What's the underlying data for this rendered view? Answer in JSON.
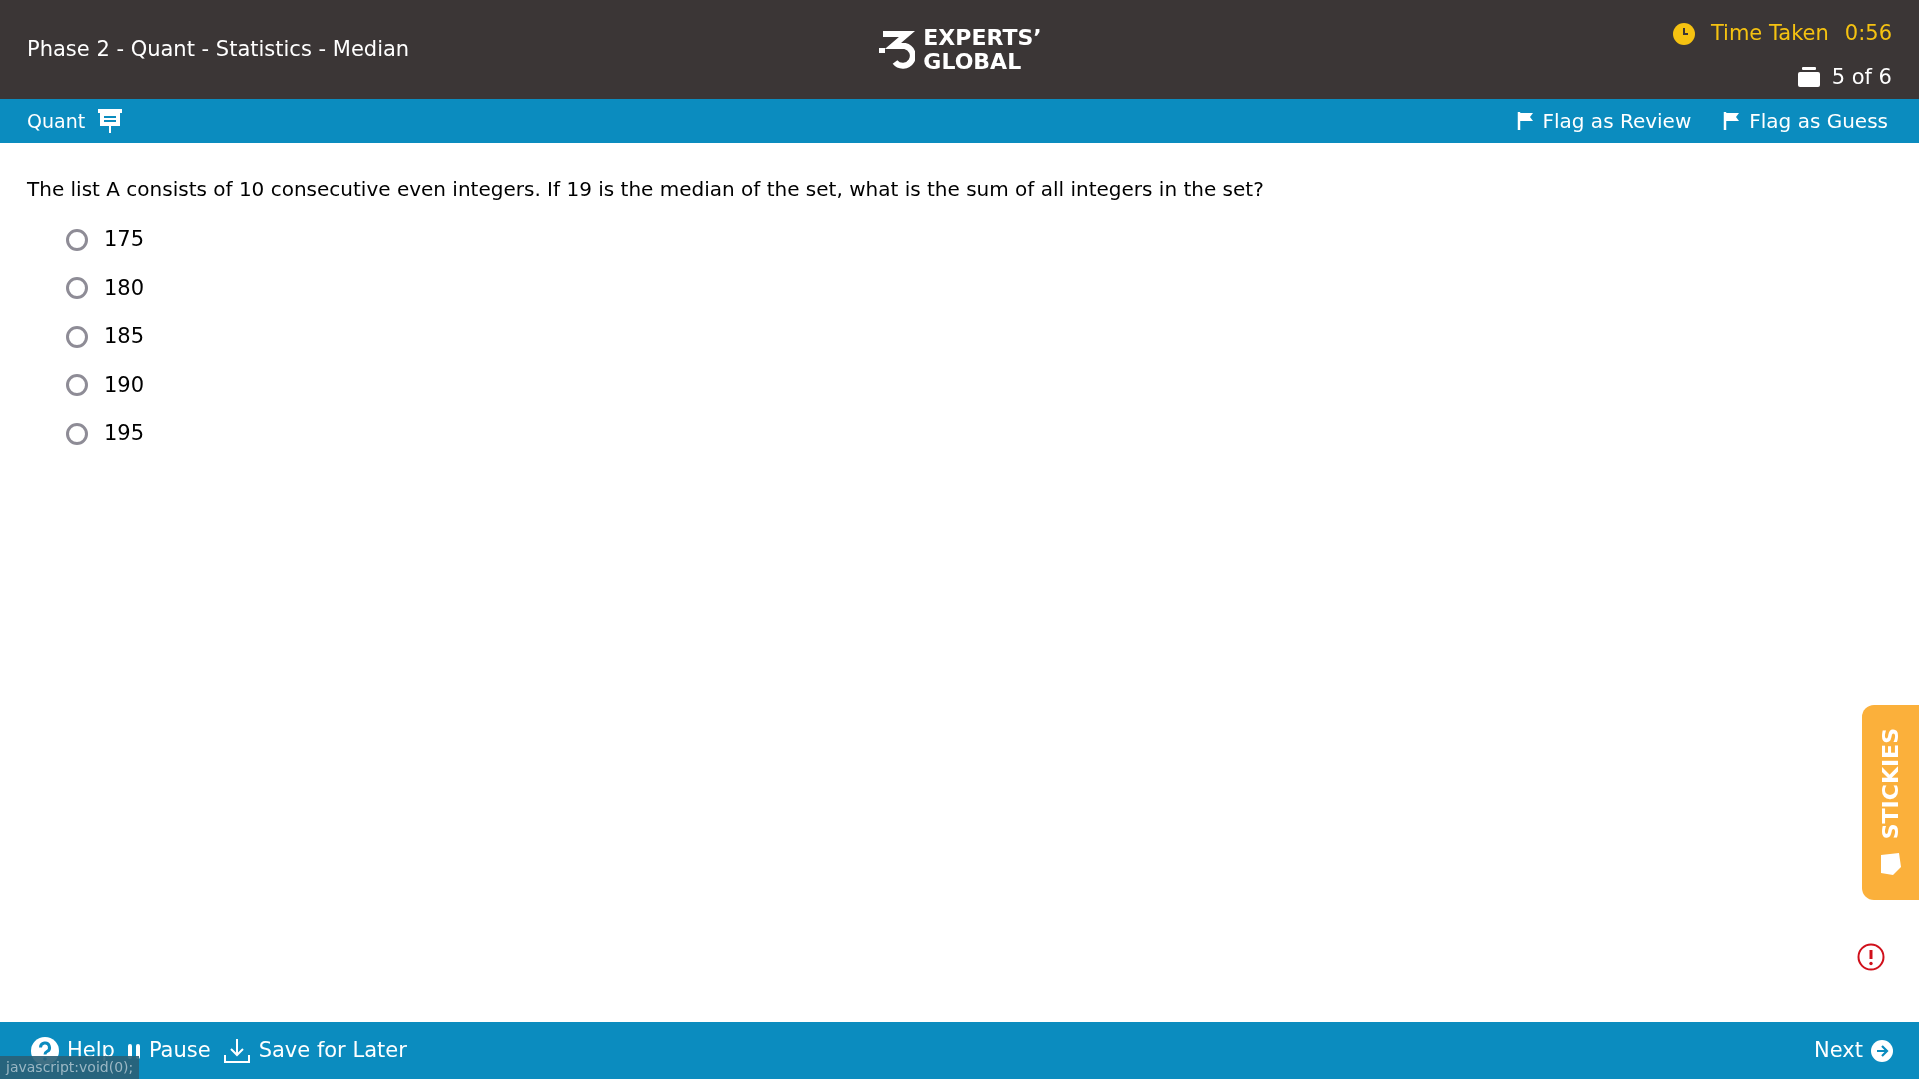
{
  "header": {
    "title": "Phase 2 - Quant - Statistics - Median",
    "logo": {
      "line_1": "EXPERTS’",
      "line_2": "GLOBAL"
    },
    "timer": {
      "label": "Time Taken",
      "value": "0:56"
    },
    "progress": "5 of 6"
  },
  "toolbar": {
    "section": "Quant",
    "flags": [
      {
        "label": "Flag as Review",
        "selected": false
      },
      {
        "label": "Flag as Guess",
        "selected": false
      }
    ]
  },
  "question": "The list A consists of 10 consecutive even integers. If 19 is the median of the set, what is the sum of all integers in the set?",
  "options": [
    {
      "label": "175",
      "selected": false
    },
    {
      "label": "180",
      "selected": false
    },
    {
      "label": "185",
      "selected": false
    },
    {
      "label": "190",
      "selected": false
    },
    {
      "label": "195",
      "selected": false
    }
  ],
  "stickies": "STICKIES",
  "footer": {
    "buttons": [
      "Help",
      "Pause",
      "Save for Later"
    ],
    "next": "Next"
  },
  "status_tooltip": "javascript:void(0);"
}
